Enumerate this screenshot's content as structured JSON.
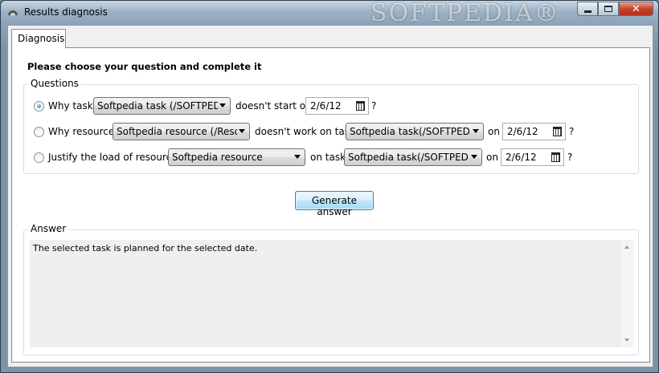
{
  "window": {
    "title": "Results diagnosis",
    "watermark": "SOFTPEDIA®",
    "controls": {
      "minimize": "minimize",
      "maximize": "maximize",
      "close": "✕"
    }
  },
  "tab": {
    "label": "Diagnosis"
  },
  "heading": "Please choose your question and complete it",
  "questions": {
    "legend": "Questions",
    "row1": {
      "selected": true,
      "label": "Why task",
      "combo": "Softpedia task (/SOFTPEDIA",
      "mid_text": "doesn't start on",
      "date": "2/6/12",
      "end": "?"
    },
    "row2": {
      "selected": false,
      "label": "Why resource",
      "combo": "Softpedia resource (/Resour",
      "mid_text": "doesn't work on task",
      "combo2": "Softpedia task(/SOFTPEDIA/",
      "on_text": "on",
      "date": "2/6/12",
      "end": "?"
    },
    "row3": {
      "selected": false,
      "label": "Justify the load of resource",
      "combo": "Softpedia resource",
      "mid_text": "on task",
      "combo2": "Softpedia task(/SOFTPEDIA/",
      "on_text": "on",
      "date": "2/6/12",
      "end": "?"
    }
  },
  "generate_button": "Generate answer",
  "answer": {
    "legend": "Answer",
    "text": "The selected task is planned for the selected date."
  }
}
